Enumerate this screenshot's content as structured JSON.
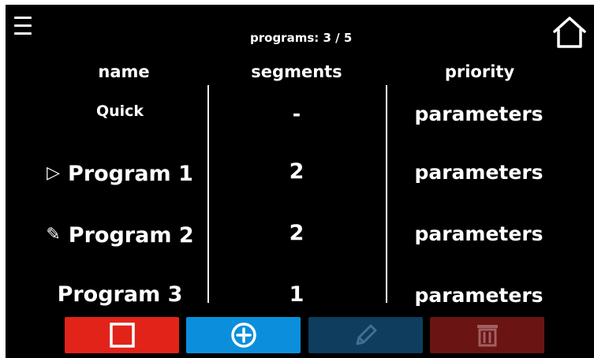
{
  "header": {
    "counter_text": "programs: 3 / 5"
  },
  "columns": {
    "name": "name",
    "segments": "segments",
    "priority": "priority"
  },
  "rows": [
    {
      "name": "Quick",
      "segments": "-",
      "priority": "parameters",
      "icon": ""
    },
    {
      "name": "Program 1",
      "segments": "2",
      "priority": "parameters",
      "icon": "play-icon"
    },
    {
      "name": "Program 2",
      "segments": "2",
      "priority": "parameters",
      "icon": "pencil-icon"
    },
    {
      "name": "Program 3",
      "segments": "1",
      "priority": "parameters",
      "icon": ""
    }
  ],
  "icons": {
    "play": "▷",
    "pencil": "✎"
  },
  "toolbar": {
    "stop_color": "#e2231a",
    "add_color": "#0b8fdc",
    "edit_color": "#0e3d5e",
    "delete_color": "#6a1414"
  }
}
